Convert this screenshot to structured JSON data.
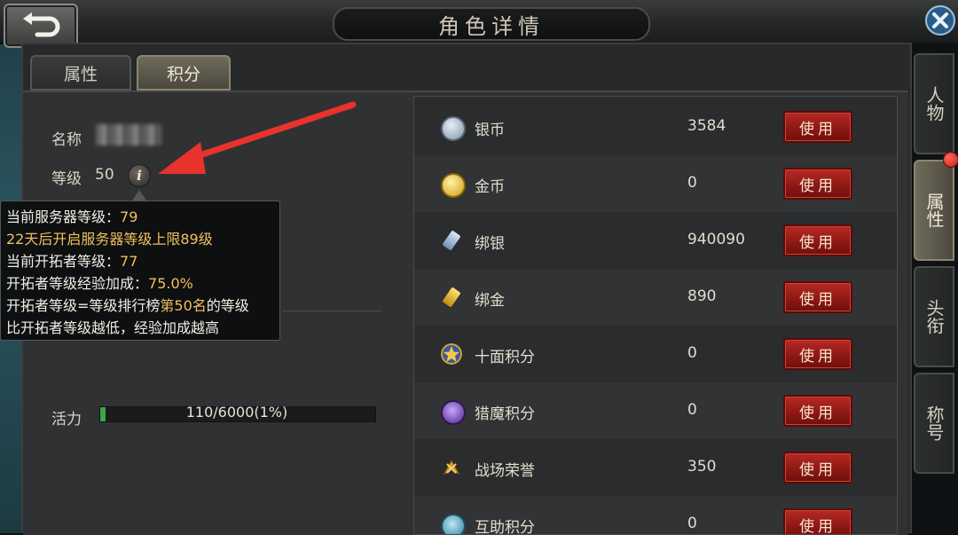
{
  "header": {
    "title": "角色详情"
  },
  "tabs": [
    {
      "label": "属性",
      "active": false
    },
    {
      "label": "积分",
      "active": true
    }
  ],
  "side_tabs": [
    {
      "label": "人物",
      "active": false
    },
    {
      "label": "属性",
      "active": true
    },
    {
      "label": "头衔",
      "active": false
    },
    {
      "label": "称号",
      "active": false
    }
  ],
  "profile": {
    "name_label": "名称",
    "level_label": "等级",
    "level_value": "50",
    "vitality_label": "活力",
    "vitality_text": "110/6000(1%)",
    "vitality_fraction": 0.0183
  },
  "tooltip": {
    "line1_prefix": "当前服务器等级：",
    "line1_value": "79",
    "line2_a": "22天后开启服务器等级上限",
    "line2_b": "89级",
    "line3_prefix": "当前开拓者等级：",
    "line3_value": "77",
    "line4_prefix": "开拓者等级经验加成：",
    "line4_value": "75.0%",
    "line5_a": "开拓者等级=等级排行榜",
    "line5_b": "第50名",
    "line5_c": "的等级",
    "line6": "比开拓者等级越低，经验加成越高"
  },
  "currencies": [
    {
      "name": "银币",
      "value": "3584",
      "button": "使用",
      "icon": "silver-coin-icon",
      "color": "#9fb3c8"
    },
    {
      "name": "金币",
      "value": "0",
      "button": "使用",
      "icon": "gold-coin-icon",
      "color": "#e0b020"
    },
    {
      "name": "绑银",
      "value": "940090",
      "button": "使用",
      "icon": "bound-silver-icon",
      "color": "#8fb0d8"
    },
    {
      "name": "绑金",
      "value": "890",
      "button": "使用",
      "icon": "bound-gold-icon",
      "color": "#e6b420"
    },
    {
      "name": "十面积分",
      "value": "0",
      "button": "使用",
      "icon": "ten-sided-star-icon",
      "color": "#d8a528"
    },
    {
      "name": "猎魔积分",
      "value": "0",
      "button": "使用",
      "icon": "demon-hunt-icon",
      "color": "#8a5ad0"
    },
    {
      "name": "战场荣誉",
      "value": "350",
      "button": "使用",
      "icon": "battle-honor-icon",
      "color": "#d89a22"
    },
    {
      "name": "互助积分",
      "value": "0",
      "button": "使用",
      "icon": "mutual-aid-icon",
      "color": "#5ab0d0"
    }
  ]
}
